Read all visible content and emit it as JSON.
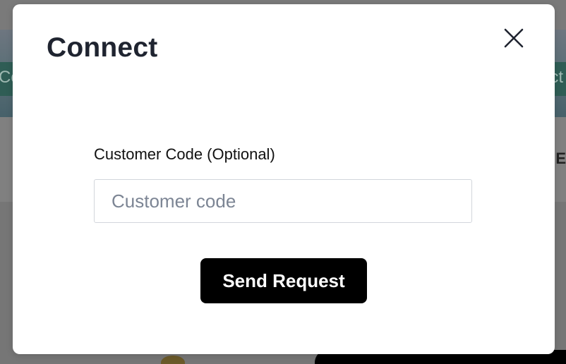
{
  "background": {
    "banner_left_text": "Co",
    "banner_right_text": "ct",
    "nav_right_text": "E"
  },
  "modal": {
    "title": "Connect",
    "close_icon": "close-icon",
    "customer_code": {
      "label": "Customer Code (Optional)",
      "placeholder": "Customer code",
      "value": ""
    },
    "submit_label": "Send Request"
  },
  "colors": {
    "overlay": "#7a7a7a",
    "modal_bg": "#ffffff",
    "title_text": "#1f2430",
    "button_bg": "#000000",
    "button_text": "#ffffff",
    "input_border": "#d2d6dc",
    "placeholder": "#7c8594"
  }
}
